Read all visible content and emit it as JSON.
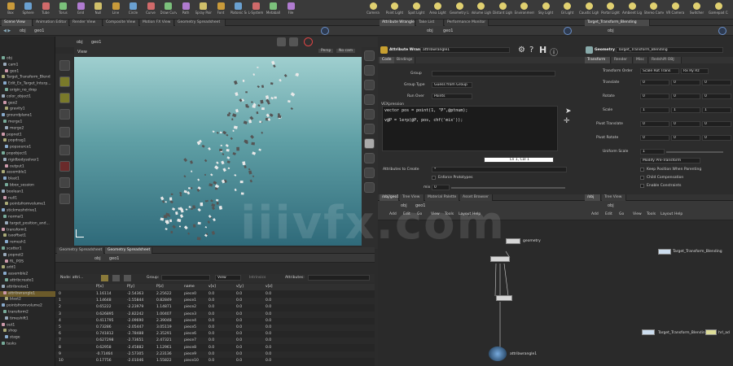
{
  "shelf": {
    "left_tools": [
      "Box",
      "Sphere",
      "Tube",
      "Torus",
      "Grid",
      "Null",
      "Line",
      "Circle",
      "Curve",
      "Draw Curve",
      "Path",
      "Spray Paint",
      "Font",
      "Platonic Solids",
      "L-System",
      "Metaball",
      "File"
    ],
    "right_tools": [
      "Camera",
      "Point Light",
      "Spot Light",
      "Area Light",
      "Geometry Light",
      "Volume Light",
      "Distant Light",
      "Environment Light",
      "Sky Light",
      "GI Light",
      "Caustic Light",
      "Portal Light",
      "Ambient Light",
      "Stereo Camera",
      "VR Camera",
      "Switcher",
      "Gamepad Camera"
    ]
  },
  "left_tabs": [
    "Scene View",
    "Animation Editor",
    "Render View",
    "Composite View",
    "Motion FX View",
    "Geometry Spreadsheet"
  ],
  "left_path": {
    "obj": "obj",
    "geo": "geo1"
  },
  "viewport": {
    "label": "View",
    "persp": "Persp",
    "camera": "No cam"
  },
  "tree": [
    {
      "label": "obj",
      "sel": false
    },
    {
      "label": "cam1",
      "sel": false
    },
    {
      "label": "geo1",
      "sel": false
    },
    {
      "label": "Target_Transform_Blend",
      "sel": false
    },
    {
      "label": "Edit_Ex_Target_Interp...",
      "sel": false
    },
    {
      "label": "origin_no_drop",
      "sel": false
    },
    {
      "label": "color_object1",
      "sel": false
    },
    {
      "label": "geo2",
      "sel": false
    },
    {
      "label": "gravity1",
      "sel": false
    },
    {
      "label": "groundplane1",
      "sel": false
    },
    {
      "label": "merge1",
      "sel": false
    },
    {
      "label": "merge2",
      "sel": false
    },
    {
      "label": "popnet1",
      "sel": false
    },
    {
      "label": "popdrag1",
      "sel": false
    },
    {
      "label": "popsource1",
      "sel": false
    },
    {
      "label": "popobject1",
      "sel": false
    },
    {
      "label": "rigidbodysolver1",
      "sel": false
    },
    {
      "label": "output1",
      "sel": false
    },
    {
      "label": "assemble1",
      "sel": false
    },
    {
      "label": "blast1",
      "sel": false
    },
    {
      "label": "bbox_session",
      "sel": false
    },
    {
      "label": "boolean1",
      "sel": false
    },
    {
      "label": "null1",
      "sel": false
    },
    {
      "label": "pointsfromvolume1",
      "sel": false
    },
    {
      "label": "stickmeshdrive1",
      "sel": false
    },
    {
      "label": "normal1",
      "sel": false
    },
    {
      "label": "target_position_and...",
      "sel": false
    },
    {
      "label": "transform1",
      "sel": false
    },
    {
      "label": "isooffset1",
      "sel": false
    },
    {
      "label": "remesh1",
      "sel": false
    },
    {
      "label": "scatter1",
      "sel": false
    },
    {
      "label": "popnet2",
      "sel": false
    },
    {
      "label": "RL_POS",
      "sel": false
    },
    {
      "label": "add1",
      "sel": false
    },
    {
      "label": "assemble2",
      "sel": false
    },
    {
      "label": "attribcreate1",
      "sel": false
    },
    {
      "label": "attribnoise1",
      "sel": false
    },
    {
      "label": "attribwrangle1",
      "sel": true
    },
    {
      "label": "blast2",
      "sel": false
    },
    {
      "label": "pointsfromvolume2",
      "sel": false
    },
    {
      "label": "transform2",
      "sel": false
    },
    {
      "label": "timeshift1",
      "sel": false
    },
    {
      "label": "out1",
      "sel": false
    },
    {
      "label": "shop",
      "sel": false
    },
    {
      "label": "stage",
      "sel": false
    },
    {
      "label": "tasks",
      "sel": false
    }
  ],
  "sheet_tabs": [
    "Geometry Spreadsheet",
    "Geometry Spreadsheet"
  ],
  "sheet_path": {
    "obj": "obj",
    "geo": "geo1"
  },
  "sheet_toolbar": {
    "node": "Node: attri...",
    "group": "Group:",
    "view": "View",
    "intrinsics": "Intrinsics",
    "attributes": "Attributes:"
  },
  "sheet_columns": [
    "",
    "P[x]",
    "P[y]",
    "P[z]",
    "name",
    "v[x]",
    "v[y]",
    "v[z]"
  ],
  "sheet_rows": [
    [
      "0",
      "1.16114",
      "-2.54363",
      "2.25622",
      "piece0",
      "0.0",
      "0.0",
      "0.0"
    ],
    [
      "1",
      "1.14648",
      "-1.55844",
      "0.82849",
      "piece1",
      "0.0",
      "0.0",
      "0.0"
    ],
    [
      "2",
      "0.65222",
      "-2.23979",
      "1.14871",
      "piece2",
      "0.0",
      "0.0",
      "0.0"
    ],
    [
      "3",
      "0.626895",
      "-2.82242",
      "1.00407",
      "piece3",
      "0.0",
      "0.0",
      "0.0"
    ],
    [
      "4",
      "0.411795",
      "-2.09690",
      "2.39048",
      "piece4",
      "0.0",
      "0.0",
      "0.0"
    ],
    [
      "5",
      "0.73286",
      "-2.05447",
      "3.05119",
      "piece5",
      "0.0",
      "0.0",
      "0.0"
    ],
    [
      "6",
      "0.741812",
      "-2.78488",
      "2.35291",
      "piece6",
      "0.0",
      "0.0",
      "0.0"
    ],
    [
      "7",
      "0.627298",
      "-2.73651",
      "2.47321",
      "piece7",
      "0.0",
      "0.0",
      "0.0"
    ],
    [
      "8",
      "0.62958",
      "-2.45882",
      "1.12961",
      "piece8",
      "0.0",
      "0.0",
      "0.0"
    ],
    [
      "9",
      "-0.71464",
      "-2.57305",
      "2.23136",
      "piece9",
      "0.0",
      "0.0",
      "0.0"
    ],
    [
      "10",
      "0.17756",
      "-2.01046",
      "1.55822",
      "piece10",
      "0.0",
      "0.0",
      "0.0"
    ]
  ],
  "wrangle_tabs": [
    "Attribute Wrangle",
    "Take List",
    "Performance Monitor"
  ],
  "wrangle": {
    "path": "attribwrangle1",
    "title": "Attribute Wrangle",
    "name": "attribwrangle1",
    "subtabs": [
      "Code",
      "Bindings"
    ],
    "group_label": "Group",
    "group_type_label": "Group Type",
    "group_type_value": "Guess from Group",
    "run_over_label": "Run Over",
    "run_over_value": "Points",
    "vexpression_label": "VEXpression",
    "code_line1": "vector pos = point(1, \"P\",@ptnum);",
    "code_line2": "v@P = lerp(@P, pos, chf('mix'));",
    "cursor": "Ln 1, Col 1",
    "attrs_label": "Attributes to Create",
    "attrs_value": "*",
    "enforce_label": "Enforce Prototypes",
    "mix_label": "mix",
    "mix_value": "0"
  },
  "geom_tabs": [
    "Target_Transform_Blending"
  ],
  "geom": {
    "title": "Geometry",
    "name": "Target_Transform_Blending",
    "subtabs": [
      "Transform",
      "Render",
      "Misc",
      "Redshift OBJ"
    ],
    "xform_order_label": "Transform Order",
    "xform_order_value": "Scale Rot Trans",
    "rot_order_value": "Rx Ry Rz",
    "rows": [
      {
        "label": "Translate",
        "v": [
          "0",
          "0",
          "0"
        ]
      },
      {
        "label": "Rotate",
        "v": [
          "0",
          "0",
          "0"
        ]
      },
      {
        "label": "Scale",
        "v": [
          "1",
          "1",
          "1"
        ]
      },
      {
        "label": "Pivot Translate",
        "v": [
          "0",
          "0",
          "0"
        ]
      },
      {
        "label": "Pivot Rotate",
        "v": [
          "0",
          "0",
          "0"
        ]
      }
    ],
    "uniform_label": "Uniform Scale",
    "uniform_value": "1",
    "modify_pre": "Modify Pre-Transform",
    "keep_pos": "Keep Position When Parenting",
    "child_comp": "Child Compensation",
    "constraints": "Enable Constraints"
  },
  "net_tabs_left": [
    "/obj/geo1",
    "Tree View",
    "Material Palette",
    "Asset Browser"
  ],
  "net_path_left": {
    "obj": "obj",
    "geo": "geo1"
  },
  "net_menu": [
    "Add",
    "Edit",
    "Go",
    "View",
    "Tools",
    "Layout",
    "Help"
  ],
  "net_nodes_left": [
    {
      "label": "geometry"
    },
    {
      "label": "attribwrangle1"
    }
  ],
  "net_tabs_right": [
    "/obj",
    "Tree View"
  ],
  "net_path_right": {
    "obj": "obj"
  },
  "net_nodes_right": [
    {
      "label": "Target_Transform_Blending"
    },
    {
      "label": "Target_Transform_Blending"
    },
    {
      "label": "hrl_ad"
    }
  ],
  "watermark": "iiivfx.com"
}
